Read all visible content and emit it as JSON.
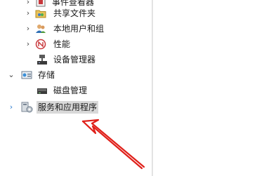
{
  "tree": {
    "items": [
      {
        "label": "事件查看器",
        "icon": "event-viewer-icon"
      },
      {
        "label": "共享文件夹",
        "icon": "shared-folder-icon"
      },
      {
        "label": "本地用户和组",
        "icon": "users-groups-icon"
      },
      {
        "label": "性能",
        "icon": "performance-icon"
      },
      {
        "label": "设备管理器",
        "icon": "device-manager-icon"
      },
      {
        "label": "存储",
        "icon": "storage-icon"
      },
      {
        "label": "磁盘管理",
        "icon": "disk-management-icon"
      },
      {
        "label": "服务和应用程序",
        "icon": "services-apps-icon",
        "selected": true
      }
    ]
  },
  "annotation": {
    "color": "#e0201a",
    "icon": "red-arrow-icon"
  }
}
